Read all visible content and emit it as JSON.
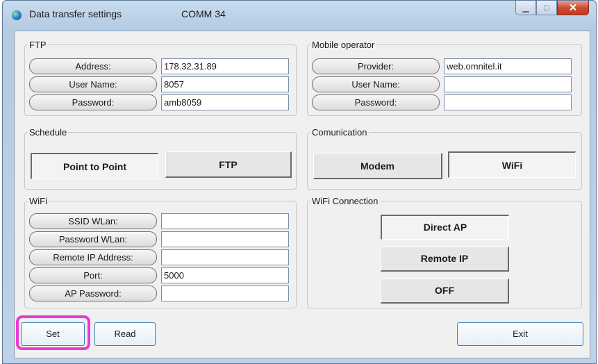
{
  "window": {
    "title": "Data transfer settings",
    "comm_port": "COMM 34"
  },
  "ftp": {
    "legend": "FTP",
    "rows": [
      {
        "label": "Address:",
        "value": "178.32.31.89"
      },
      {
        "label": "User Name:",
        "value": "8057"
      },
      {
        "label": "Password:",
        "value": "amb8059"
      }
    ]
  },
  "mobile": {
    "legend": "Mobile operator",
    "rows": [
      {
        "label": "Provider:",
        "value": "web.omnitel.it"
      },
      {
        "label": "User Name:",
        "value": ""
      },
      {
        "label": "Password:",
        "value": ""
      }
    ]
  },
  "schedule": {
    "legend": "Schedule",
    "buttons": [
      {
        "label": "Point to Point",
        "state": "pressed"
      },
      {
        "label": "FTP",
        "state": "raised"
      }
    ]
  },
  "communication": {
    "legend": "Comunication",
    "buttons": [
      {
        "label": "Modem",
        "state": "raised"
      },
      {
        "label": "WiFi",
        "state": "pressed"
      }
    ]
  },
  "wifi": {
    "legend": "WiFi",
    "rows": [
      {
        "label": "SSID WLan:",
        "value": ""
      },
      {
        "label": "Password WLan:",
        "value": ""
      },
      {
        "label": "Remote IP Address:",
        "value": ""
      },
      {
        "label": "Port:",
        "value": "5000"
      },
      {
        "label": "AP Password:",
        "value": ""
      }
    ]
  },
  "wifi_connection": {
    "legend": "WiFi Connection",
    "buttons": [
      {
        "label": "Direct AP",
        "state": "pressed"
      },
      {
        "label": "Remote IP",
        "state": "raised"
      },
      {
        "label": "OFF",
        "state": "raised"
      }
    ]
  },
  "footer": {
    "set": "Set",
    "read": "Read",
    "exit": "Exit"
  },
  "colors": {
    "highlight": "#e83ad6",
    "button_border": "#3c7fb1",
    "close_button": "#c23a22"
  }
}
